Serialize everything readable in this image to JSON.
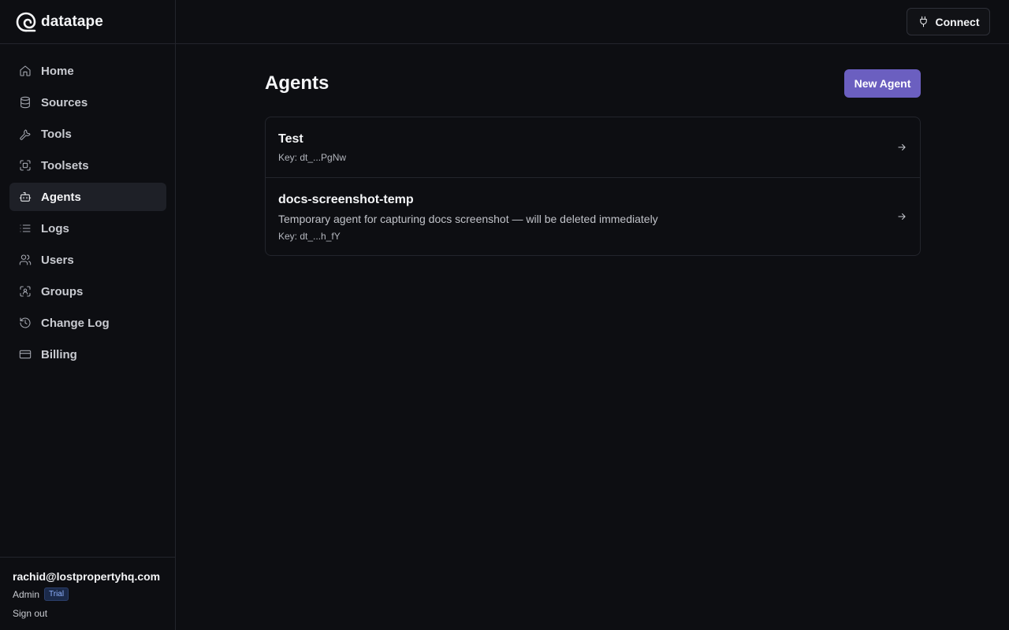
{
  "brand": {
    "name": "datatape",
    "logo_icon": "spiral-logo-icon"
  },
  "topbar": {
    "connect_label": "Connect",
    "connect_icon": "plug-icon"
  },
  "sidebar": {
    "items": [
      {
        "label": "Home",
        "icon": "home-icon",
        "active": false
      },
      {
        "label": "Sources",
        "icon": "database-icon",
        "active": false
      },
      {
        "label": "Tools",
        "icon": "wrench-icon",
        "active": false
      },
      {
        "label": "Toolsets",
        "icon": "scan-icon",
        "active": false
      },
      {
        "label": "Agents",
        "icon": "bot-icon",
        "active": true
      },
      {
        "label": "Logs",
        "icon": "list-icon",
        "active": false
      },
      {
        "label": "Users",
        "icon": "users-icon",
        "active": false
      },
      {
        "label": "Groups",
        "icon": "user-scan-icon",
        "active": false
      },
      {
        "label": "Change Log",
        "icon": "history-icon",
        "active": false
      },
      {
        "label": "Billing",
        "icon": "credit-card-icon",
        "active": false
      }
    ]
  },
  "account": {
    "email": "rachid@lostpropertyhq.com",
    "role": "Admin",
    "plan_badge": "Trial",
    "sign_out_label": "Sign out"
  },
  "main": {
    "title": "Agents",
    "new_button_label": "New Agent",
    "agents": [
      {
        "name": "Test",
        "description": "",
        "key": "Key: dt_...PgNw"
      },
      {
        "name": "docs-screenshot-temp",
        "description": "Temporary agent for capturing docs screenshot — will be deleted immediately",
        "key": "Key: dt_...h_fY"
      }
    ]
  },
  "colors": {
    "background": "#0d0e12",
    "accent": "#6b5fc0",
    "active_nav": "#1e2027",
    "border": "#23252c"
  }
}
